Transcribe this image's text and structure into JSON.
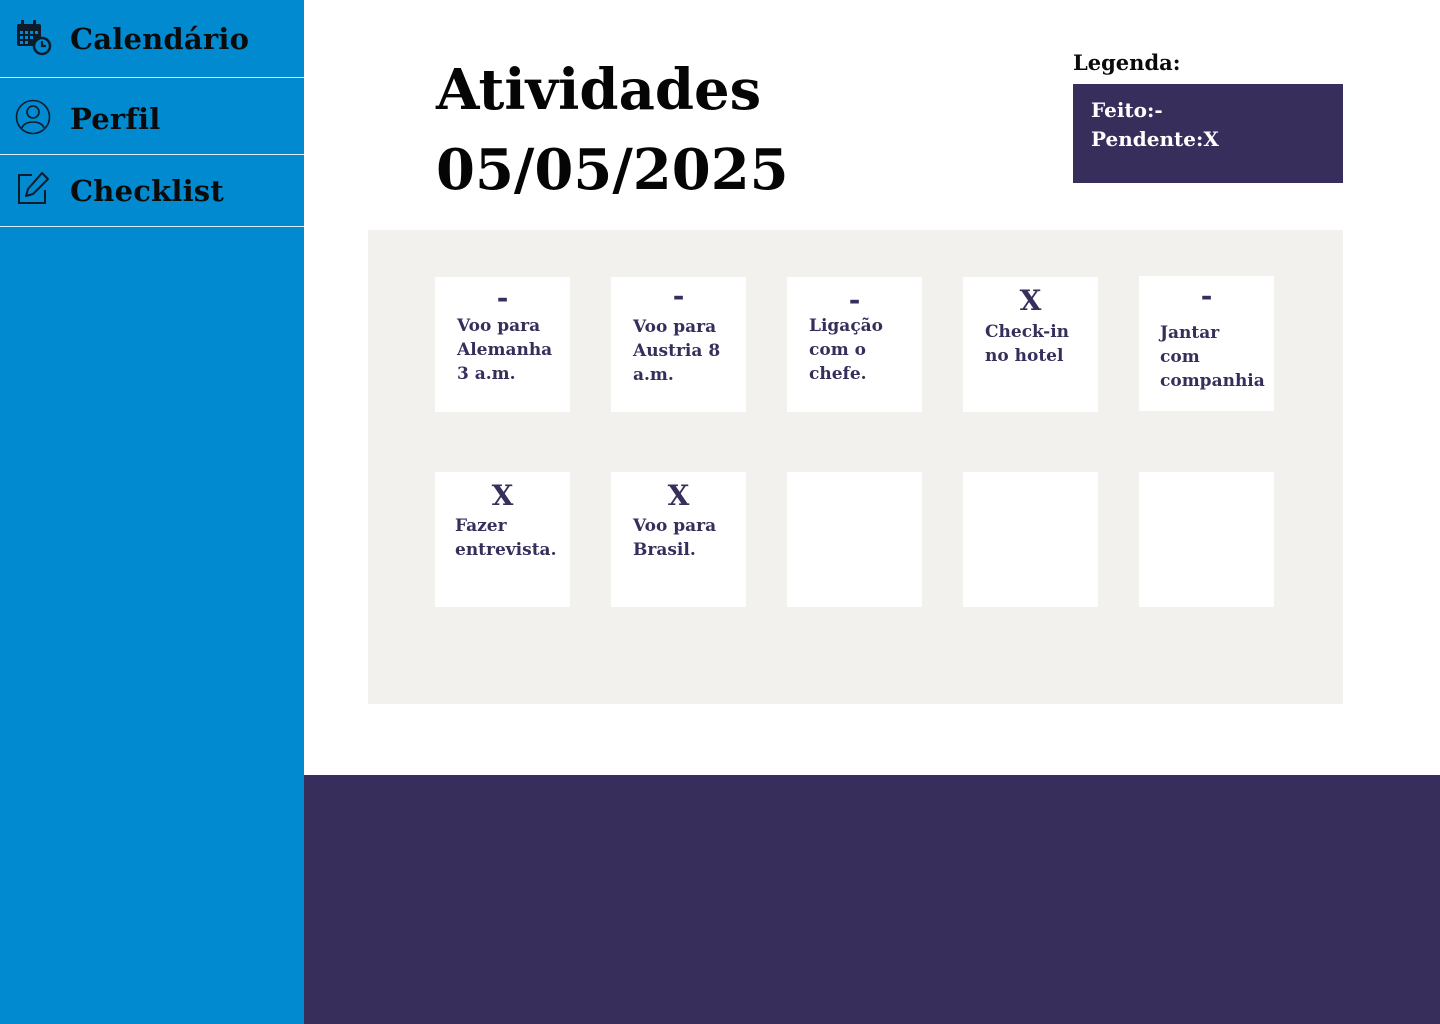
{
  "sidebar": {
    "items": [
      {
        "label": "Calendário",
        "icon": "calendar-clock-icon"
      },
      {
        "label": "Perfil",
        "icon": "user-icon"
      },
      {
        "label": "Checklist",
        "icon": "edit-icon"
      }
    ]
  },
  "header": {
    "title": "Atividades",
    "date": "05/05/2025"
  },
  "legend": {
    "title": "Legenda:",
    "done": "Feito:-",
    "pending": "Pendente:X"
  },
  "cards": [
    {
      "mark": "-",
      "text": "Voo para Alemanha 3 a.m."
    },
    {
      "mark": "-",
      "text": "Voo para Austria 8 a.m."
    },
    {
      "mark": "-",
      "text": "Ligação com o chefe."
    },
    {
      "mark": "X",
      "text": "Check-in no hotel"
    },
    {
      "mark": "-",
      "text": "Jantar com companhia"
    },
    {
      "mark": "X",
      "text": "Fazer entrevista."
    },
    {
      "mark": "X",
      "text": "Voo para Brasil."
    },
    {
      "mark": "",
      "text": ""
    },
    {
      "mark": "",
      "text": ""
    },
    {
      "mark": "",
      "text": ""
    }
  ],
  "colors": {
    "sidebar": "#018ACF",
    "accent": "#382E5C",
    "board": "#F2F1EE"
  }
}
